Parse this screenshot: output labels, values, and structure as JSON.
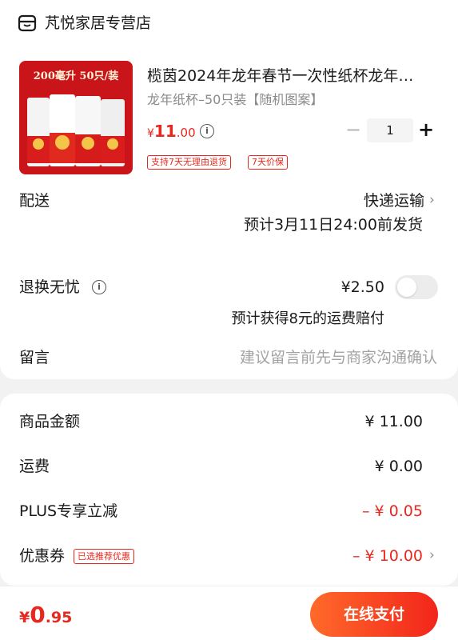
{
  "store": {
    "name": "芃悦家居专营店",
    "icon": "store-icon"
  },
  "product": {
    "image_banner": "200毫升 50只/装",
    "title": "榄茵2024年龙年春节一次性纸杯龙年…",
    "variant": "龙年纸杯–50只装【随机图案】",
    "price_symbol": "¥",
    "price_int": "11",
    "price_dec": ".00",
    "quantity": "1",
    "qty_minus": "−",
    "qty_plus": "+",
    "badges": [
      "支持7天无理由退货",
      "7天价保"
    ]
  },
  "delivery": {
    "label": "配送",
    "method": "快递运输",
    "chevron": "›",
    "estimate": "预计3月11日24:00前发货"
  },
  "return_insurance": {
    "label": "退换无忧",
    "price": "¥2.50",
    "note": "预计获得8元的运费赔付"
  },
  "message": {
    "label": "留言",
    "placeholder": "建议留言前先与商家沟通确认"
  },
  "summary": {
    "goods": {
      "label": "商品金额",
      "value": "¥ 11.00"
    },
    "shipping": {
      "label": "运费",
      "value": "¥ 0.00"
    },
    "plus": {
      "label": "PLUS专享立减",
      "value": "– ¥ 0.05"
    },
    "coupon": {
      "label": "优惠券",
      "tag": "已选推荐优惠",
      "value": "– ¥ 10.00",
      "chevron": "›"
    }
  },
  "footer": {
    "total_symbol": "¥",
    "total_int": "0",
    "total_dec": ".95",
    "pay_label": "在线支付"
  },
  "colors": {
    "accent": "#e8281f",
    "pay_gradient_start": "#ff6a2a",
    "pay_gradient_end": "#f2251b"
  }
}
